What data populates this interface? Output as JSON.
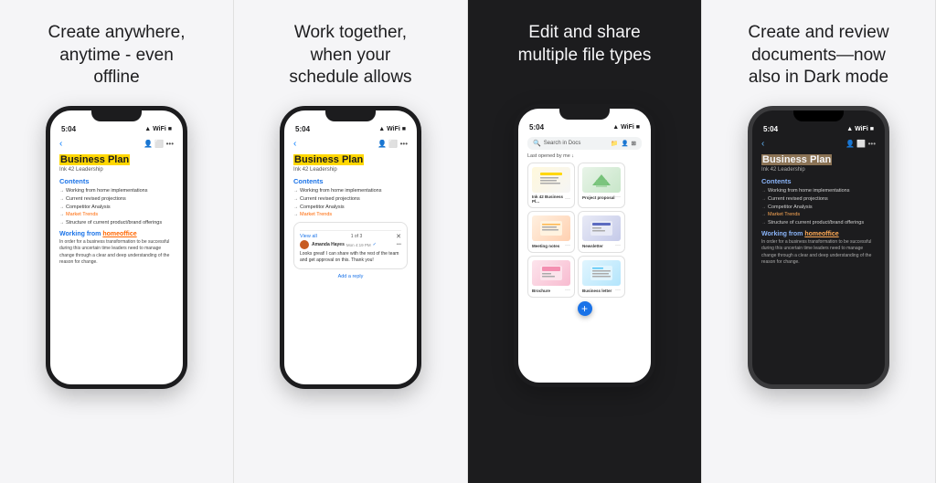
{
  "panels": [
    {
      "id": "panel-1",
      "title": "Create anywhere,\nanytime - even\noffline",
      "theme": "light",
      "phone": {
        "time": "5:04",
        "hasNotch": true,
        "docTitle": "Business Plan",
        "docSubtitle": "Ink 42 Leadership",
        "titleHighlight": true,
        "contents_label": "Contents",
        "list_items": [
          {
            "text": "Working from home implementations",
            "highlighted": false
          },
          {
            "text": "Current revised projections",
            "highlighted": false
          },
          {
            "text": "Competitor Analysis",
            "highlighted": false
          },
          {
            "text": "Market Trends",
            "highlighted": true
          },
          {
            "text": "Structure of current product/brand offerings",
            "highlighted": false
          }
        ],
        "working_from": "Working from home",
        "home_link": "homeoffice",
        "body_text": "In order for a business transformation to be successful during this uncertain time leaders need to manage change through a clear and deep understanding of the reason for change."
      }
    },
    {
      "id": "panel-2",
      "title": "Work together,\nwhen your\nschedule allows",
      "theme": "light",
      "phone": {
        "time": "5:04",
        "hasNotch": true,
        "docTitle": "Business Plan",
        "docSubtitle": "Ink 42 Leadership",
        "titleHighlight": true,
        "contents_label": "Contents",
        "list_items": [
          {
            "text": "Working from home implementations",
            "highlighted": false
          },
          {
            "text": "Current revised projections",
            "highlighted": false
          },
          {
            "text": "Competitor Analysis",
            "highlighted": false
          },
          {
            "text": "Market Trends",
            "highlighted": true
          }
        ],
        "comment": {
          "view_all": "View all",
          "pagination": "1 of 3",
          "avatar_initial": "A",
          "name": "Amanda Hayes",
          "time": "Mon 4:19 PM",
          "text": "Looks great! I can share with the rest of the team and get approval on this. Thank you!"
        },
        "add_reply": "Add a reply"
      }
    },
    {
      "id": "panel-3",
      "title": "Edit and share\nmultiple file types",
      "theme": "light",
      "phone": {
        "time": "5:04",
        "hasNotch": true,
        "search_placeholder": "Search in Docs",
        "files_label": "Last opened by me",
        "files": [
          {
            "name": "Ink 42 Business Pl...",
            "thumb": "bp",
            "dots": "···"
          },
          {
            "name": "Project proposal",
            "thumb": "proj",
            "dots": "···"
          },
          {
            "name": "Meeting notes",
            "thumb": "meeting",
            "dots": "···"
          },
          {
            "name": "Newsletter",
            "thumb": "newsletter",
            "dots": "···"
          },
          {
            "name": "Brochure",
            "thumb": "brochure",
            "dots": "···"
          },
          {
            "name": "Business letter",
            "thumb": "bizletter",
            "dots": "···"
          }
        ],
        "fab_icon": "+"
      }
    },
    {
      "id": "panel-4",
      "title": "Create and review\ndocuments—now\nalso in Dark mode",
      "theme": "dark",
      "phone": {
        "time": "5:04",
        "hasNotch": true,
        "docTitle": "Business Plan",
        "docSubtitle": "Ink 42 Leadership",
        "titleHighlight": true,
        "contents_label": "Contents",
        "list_items": [
          {
            "text": "Working from home implementations",
            "highlighted": false
          },
          {
            "text": "Current revised projections",
            "highlighted": false
          },
          {
            "text": "Competitor Analysis",
            "highlighted": false
          },
          {
            "text": "Market Trends",
            "highlighted": true
          },
          {
            "text": "Structure of current product/brand offerings",
            "highlighted": false
          }
        ],
        "working_from": "Working from home",
        "home_link": "homeoffice",
        "body_text": "In order for a business transformation to be successful during this uncertain time leaders need to manage change through a clear and deep understanding of the reason for change."
      }
    }
  ]
}
